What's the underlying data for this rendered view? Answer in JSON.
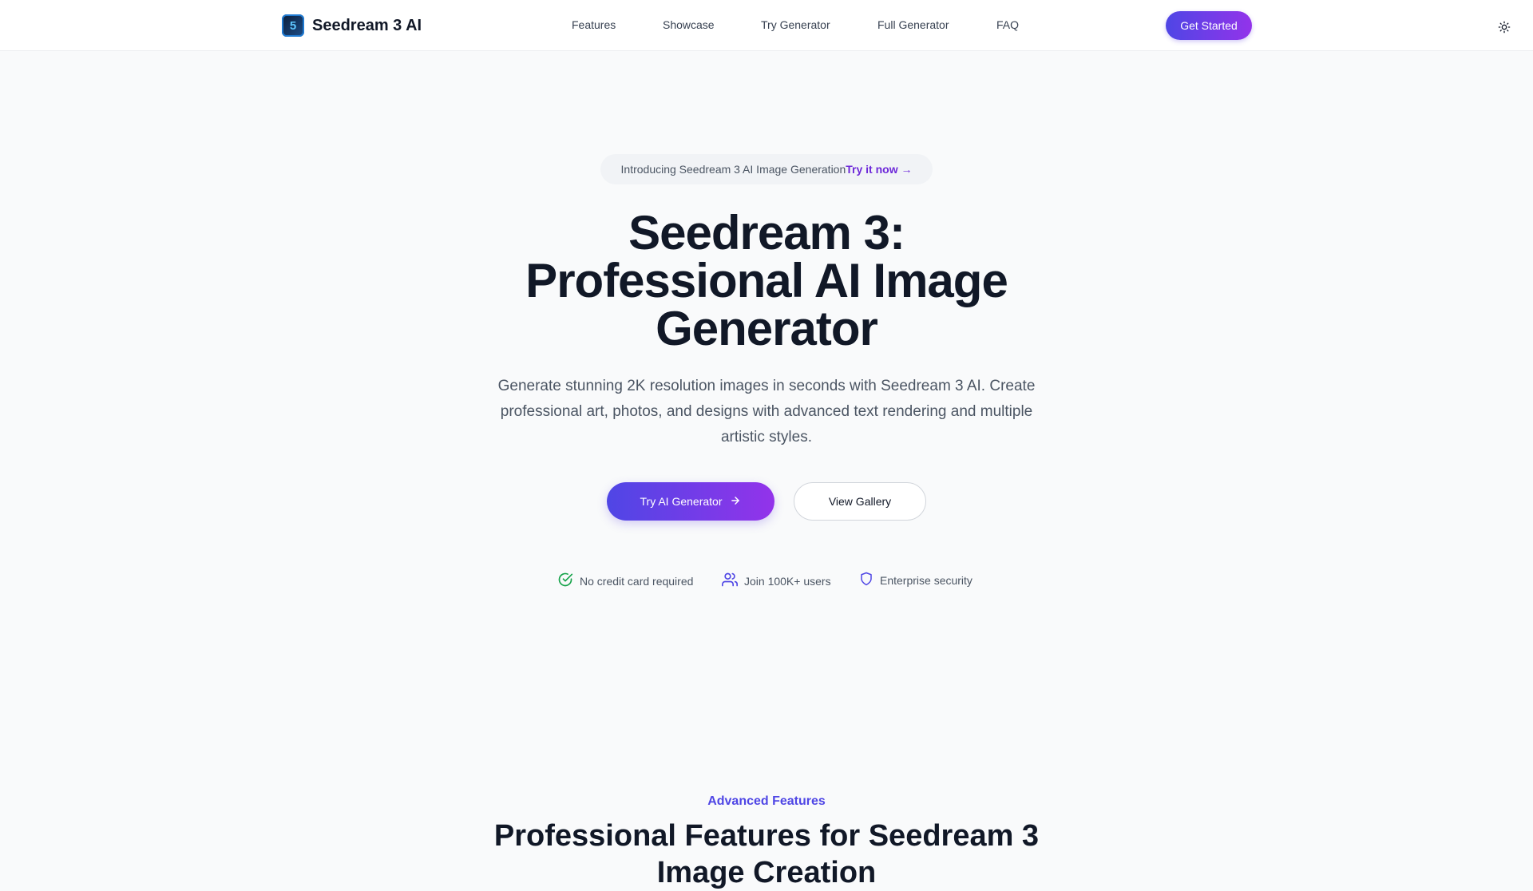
{
  "header": {
    "brand": {
      "logo_text": "5",
      "name": "Seedream 3 AI"
    },
    "nav": [
      {
        "label": "Features"
      },
      {
        "label": "Showcase"
      },
      {
        "label": "Try Generator"
      },
      {
        "label": "Full Generator"
      },
      {
        "label": "FAQ"
      }
    ],
    "cta_label": "Get Started",
    "theme_icon": "sun-icon"
  },
  "hero": {
    "badge_text": "Introducing Seedream 3 AI Image Generation",
    "badge_link": "Try it now →",
    "title_lines": [
      "Seedream 3:",
      "Professional AI Image",
      "Generator"
    ],
    "subtitle": "Generate stunning 2K resolution images in seconds with Seedream 3 AI. Create professional art, photos, and designs with advanced text rendering and multiple artistic styles.",
    "primary_button": "Try AI Generator",
    "secondary_button": "View Gallery",
    "trust": [
      {
        "icon": "check-circle-icon",
        "label": "No credit card required"
      },
      {
        "icon": "users-icon",
        "label": "Join 100K+ users"
      },
      {
        "icon": "shield-icon",
        "label": "Enterprise security"
      }
    ]
  },
  "features": {
    "eyebrow": "Advanced Features",
    "title": "Professional Features for Seedream 3 Image Creation"
  },
  "colors": {
    "accent_start": "#4f46e5",
    "accent_end": "#9333ea",
    "success": "#16a34a"
  }
}
